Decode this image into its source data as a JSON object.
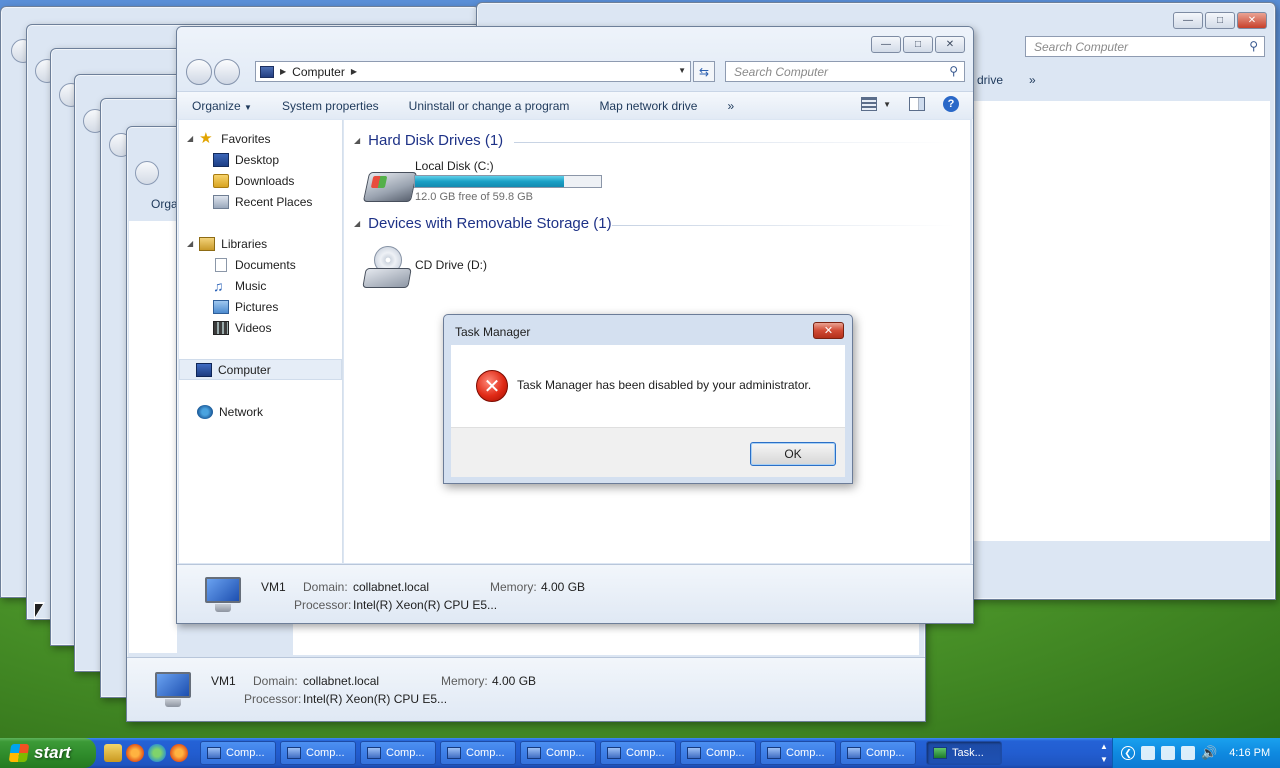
{
  "main_window": {
    "address_crumb": "Computer",
    "search_placeholder": "Search Computer",
    "toolbar": {
      "organize": "Organize",
      "system_properties": "System properties",
      "uninstall": "Uninstall or change a program",
      "map_network_drive": "Map network drive",
      "more": "»"
    },
    "nav": {
      "favorites": "Favorites",
      "desktop": "Desktop",
      "downloads": "Downloads",
      "recent_places": "Recent Places",
      "libraries": "Libraries",
      "documents": "Documents",
      "music": "Music",
      "pictures": "Pictures",
      "videos": "Videos",
      "computer": "Computer",
      "network": "Network"
    },
    "groups": {
      "hard_disk": "Hard Disk Drives (1)",
      "removable": "Devices with Removable Storage (1)"
    },
    "drives": {
      "c_name": "Local Disk (C:)",
      "c_free": "12.0 GB free of 59.8 GB",
      "c_used_fraction": 0.8,
      "d_name": "CD Drive (D:)"
    },
    "details": {
      "name": "VM1",
      "domain_label": "Domain:",
      "domain": "collabnet.local",
      "memory_label": "Memory:",
      "memory": "4.00 GB",
      "processor_label": "Processor:",
      "processor": "Intel(R) Xeon(R) CPU E5..."
    }
  },
  "background": {
    "right_window_search": "Search Computer",
    "right_window_toolbar": "drive",
    "right_window_more": "»",
    "left_window_toolbar": "Orga",
    "bottom_window": {
      "name": "VM1",
      "domain_label": "Domain:",
      "domain": "collabnet.local",
      "memory_label": "Memory:",
      "memory": "4.00 GB",
      "processor_label": "Processor:",
      "processor": "Intel(R) Xeon(R) CPU E5..."
    }
  },
  "dialog": {
    "title": "Task Manager",
    "message": "Task Manager has been disabled by your administrator.",
    "ok_label": "OK",
    "close_glyph": "✕"
  },
  "taskbar": {
    "start_label": "start",
    "buttons": [
      "Comp...",
      "Comp...",
      "Comp...",
      "Comp...",
      "Comp...",
      "Comp...",
      "Comp...",
      "Comp...",
      "Comp..."
    ],
    "active_button": "Task...",
    "clock": "4:16 PM"
  },
  "colors": {
    "accent": "#2a68c8",
    "group_header": "#1e3287",
    "usage_fill": "#1aa0c6",
    "taskbar": "#225dd0",
    "start_green": "#2e8a2a",
    "error_red": "#e02a16"
  }
}
